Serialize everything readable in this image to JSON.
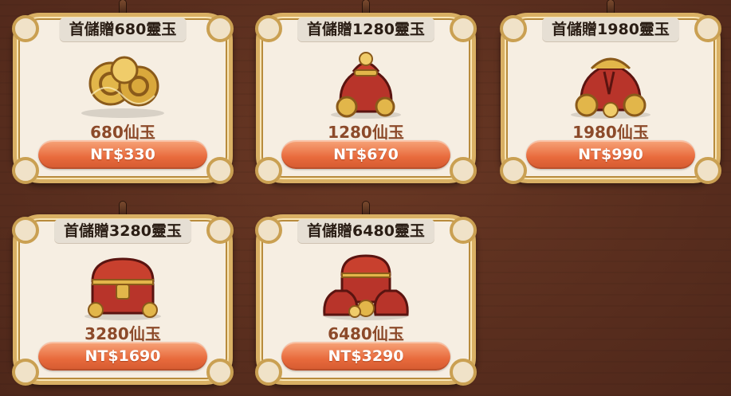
{
  "cards": [
    {
      "title": "首儲贈680靈玉",
      "amount": "680仙玉",
      "price": "NT$330",
      "art_icon": "gold-ingots-icon"
    },
    {
      "title": "首儲贈1280靈玉",
      "amount": "1280仙玉",
      "price": "NT$670",
      "art_icon": "red-treasure-bag-icon"
    },
    {
      "title": "首儲贈1980靈玉",
      "amount": "1980仙玉",
      "price": "NT$990",
      "art_icon": "large-treasure-bag-icon"
    },
    {
      "title": "首儲贈3280靈玉",
      "amount": "3280仙玉",
      "price": "NT$1690",
      "art_icon": "treasure-chest-icon"
    },
    {
      "title": "首儲贈6480靈玉",
      "amount": "6480仙玉",
      "price": "NT$3290",
      "art_icon": "treasure-chest-with-bags-icon"
    }
  ],
  "colors": {
    "background": "#5b2e1e",
    "card_fill": "#f6eee2",
    "card_border": "#d9b064",
    "amount_text": "#8c4a2a",
    "price_button": "#e86a3c",
    "gold": "#e2b64a",
    "red": "#b8342a"
  }
}
